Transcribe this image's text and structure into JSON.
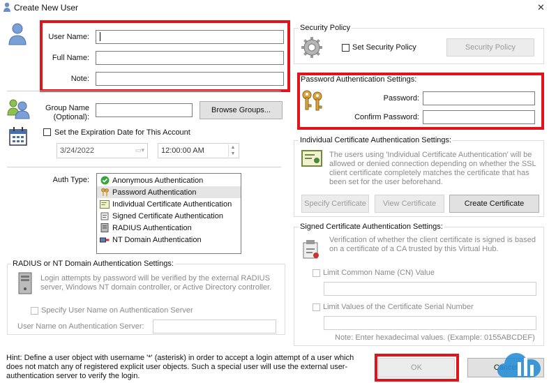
{
  "window": {
    "title": "Create New User",
    "close_glyph": "✕"
  },
  "user": {
    "username_label": "User Name:",
    "username_value": "",
    "fullname_label": "Full Name:",
    "fullname_value": "",
    "note_label": "Note:",
    "note_value": ""
  },
  "group": {
    "label": "Group Name\n(Optional):",
    "value": "",
    "browse_label": "Browse Groups..."
  },
  "expiration": {
    "checkbox_label": "Set the Expiration Date for This Account",
    "date_value": "3/24/2022",
    "time_value": "12:00:00 AM"
  },
  "auth": {
    "label": "Auth Type:",
    "selected_index": 1,
    "items": [
      {
        "label": "Anonymous Authentication",
        "icon": "check-circle-icon"
      },
      {
        "label": "Password Authentication",
        "icon": "keys-icon"
      },
      {
        "label": "Individual Certificate Authentication",
        "icon": "certificate-icon"
      },
      {
        "label": "Signed Certificate Authentication",
        "icon": "signed-certificate-icon"
      },
      {
        "label": "RADIUS Authentication",
        "icon": "radius-icon"
      },
      {
        "label": "NT Domain Authentication",
        "icon": "nt-domain-icon"
      }
    ]
  },
  "radius": {
    "title": "RADIUS or NT Domain Authentication Settings:",
    "description": "Login attempts by password will be verified by the external RADIUS server, Windows NT domain controller, or Active Directory controller.",
    "specify_label": "Specify User Name on Authentication Server",
    "server_user_label": "User Name on Authentication Server:",
    "server_user_value": ""
  },
  "hint": "Hint: Define a user object with username '*' (asterisk) in order to accept a login attempt of a user which does not match any of registered explicit user objects. Such a special user will use the external user-authentication server to verify the login.",
  "security": {
    "title": "Security Policy",
    "checkbox_label": "Set Security Policy",
    "button_label": "Security Policy"
  },
  "password": {
    "title": "Password Authentication Settings:",
    "password_label": "Password:",
    "password_value": "",
    "confirm_label": "Confirm Password:",
    "confirm_value": ""
  },
  "individual_cert": {
    "title": "Individual Certificate Authentication Settings:",
    "description": "The users using 'Individual Certificate Authentication' will be allowed or denied connection depending on whether the SSL client certificate completely matches the certificate that has been set for the user beforehand.",
    "specify_label": "Specify Certificate",
    "view_label": "View Certificate",
    "create_label": "Create Certificate"
  },
  "signed_cert": {
    "title": "Signed Certificate Authentication Settings:",
    "description": "Verification of whether the client certificate is signed is based on a certificate of a CA trusted by this Virtual Hub.",
    "cn_label": "Limit Common Name (CN) Value",
    "cn_value": "",
    "serial_label": "Limit Values of the Certificate Serial Number",
    "serial_value": "",
    "note": "Note: Enter hexadecimal values. (Example: 0155ABCDEF)"
  },
  "footer": {
    "ok_label": "OK",
    "cancel_label": "Cancel"
  },
  "colors": {
    "highlight": "#e0151b",
    "focus": "#0078d7"
  }
}
